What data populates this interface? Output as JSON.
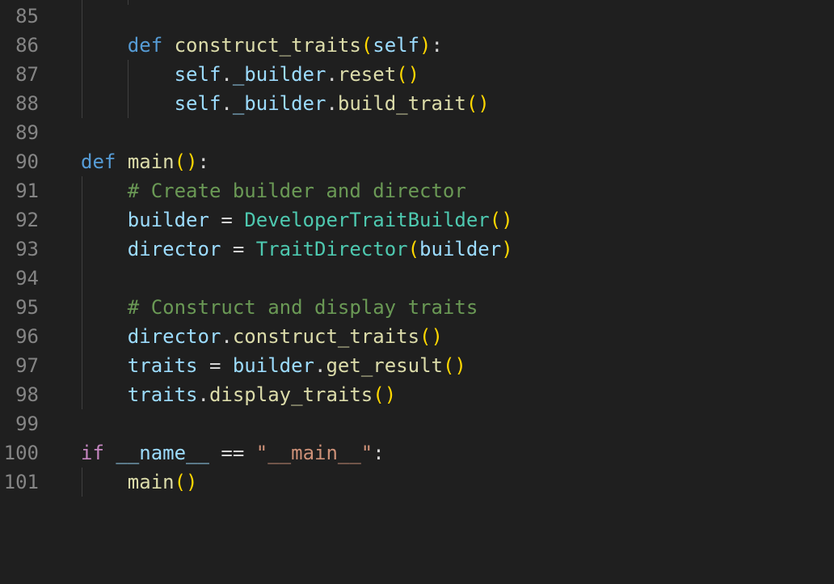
{
  "editor": {
    "line_numbers": [
      "85",
      "86",
      "87",
      "88",
      "89",
      "90",
      "91",
      "92",
      "93",
      "94",
      "95",
      "96",
      "97",
      "98",
      "99",
      "100",
      "101"
    ],
    "tokens": {
      "def": "def",
      "construct_traits": "construct_traits",
      "self": "self",
      "dot": ".",
      "colon": ":",
      "lparen": "(",
      "rparen": ")",
      "builder_attr": "_builder",
      "reset": "reset",
      "build_trait": "build_trait",
      "main": "main",
      "comment1": "# Create builder and director",
      "builder": "builder",
      "eq": "=",
      "DeveloperTraitBuilder": "DeveloperTraitBuilder",
      "director": "director",
      "TraitDirector": "TraitDirector",
      "comment2": "# Construct and display traits",
      "traits": "traits",
      "get_result": "get_result",
      "display_traits": "display_traits",
      "if": "if",
      "dunder_name": "__name__",
      "eqeq": "==",
      "main_str": "\"__main__\""
    }
  }
}
